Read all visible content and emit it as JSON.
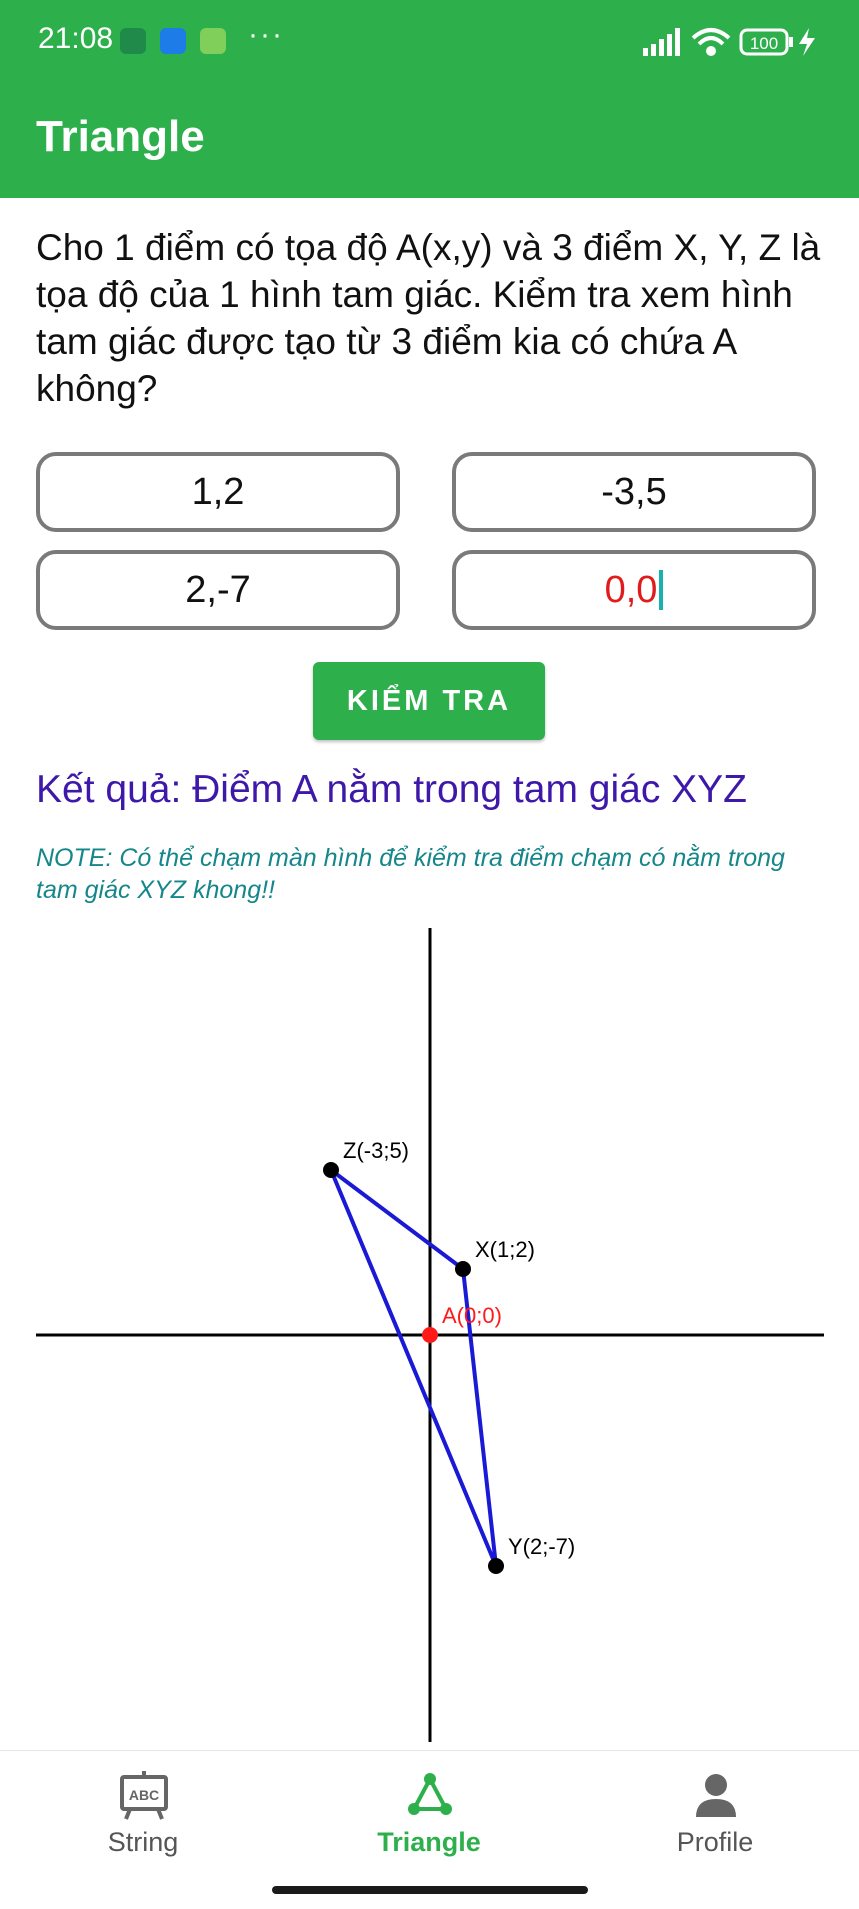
{
  "status": {
    "time": "21:08",
    "battery": "100"
  },
  "appbar": {
    "title": "Triangle"
  },
  "question": "Cho 1 điểm có  tọa độ A(x,y) và 3 điểm X, Y, Z là tọa độ của 1 hình tam giác. Kiểm tra xem hình tam giác được tạo từ 3 điểm kia có chứa A không?",
  "inputs": {
    "x": "1,2",
    "z": "-3,5",
    "y": "2,-7",
    "a": "0,0"
  },
  "button": {
    "label": "KIỂM TRA"
  },
  "result": "Kết quả: Điểm A nằm trong tam giác XYZ",
  "note": "NOTE: Có thể chạm màn hình để kiểm tra điểm chạm có nằm trong tam giác XYZ khong!!",
  "plot": {
    "points": [
      {
        "label": "X(1;2)",
        "x": 1,
        "y": 2,
        "color": "#000000"
      },
      {
        "label": "Y(2;-7)",
        "x": 2,
        "y": -7,
        "color": "#000000"
      },
      {
        "label": "Z(-3;5)",
        "x": -3,
        "y": 5,
        "color": "#000000"
      },
      {
        "label": "A(0;0)",
        "x": 0,
        "y": 0,
        "color": "#ff1a1a"
      }
    ],
    "triangle_color": "#1a1ad6"
  },
  "nav": [
    {
      "label": "String",
      "icon": "abc-board-icon",
      "active": false
    },
    {
      "label": "Triangle",
      "icon": "triangle-nodes-icon",
      "active": true
    },
    {
      "label": "Profile",
      "icon": "person-icon",
      "active": false
    }
  ],
  "colors": {
    "primary": "#2db04c",
    "result": "#3e18a8",
    "note": "#15878a"
  }
}
